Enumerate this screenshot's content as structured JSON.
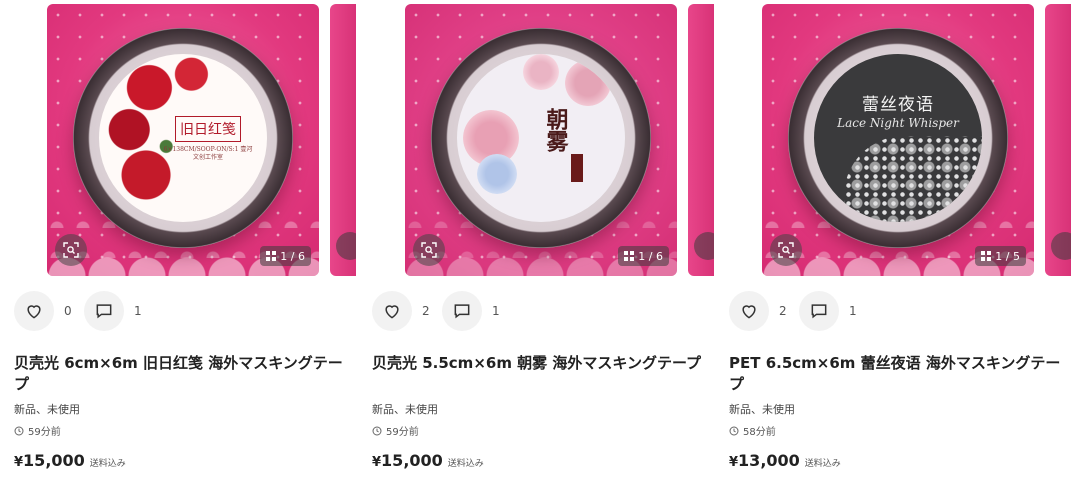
{
  "items": [
    {
      "likes": "0",
      "comments": "1",
      "title": "贝壳光 6cm×6m 旧日红笺 海外マスキングテープ",
      "condition": "新品、未使用",
      "time": "59分前",
      "currency": "¥",
      "price": "15,000",
      "shipping": "送料込み",
      "page_indicator": "1 / 6",
      "tape_label": "旧日红笺",
      "tape_sub": "6×138CM/SOOP-ON/S:1 壹河文创工作室"
    },
    {
      "likes": "2",
      "comments": "1",
      "title": "贝壳光 5.5cm×6m 朝雾 海外マスキングテープ",
      "condition": "新品、未使用",
      "time": "59分前",
      "currency": "¥",
      "price": "15,000",
      "shipping": "送料込み",
      "page_indicator": "1 / 6",
      "tape_label": "朝雾"
    },
    {
      "likes": "2",
      "comments": "1",
      "title": "PET 6.5cm×6m 蕾丝夜语 海外マスキングテープ",
      "condition": "新品、未使用",
      "time": "58分前",
      "currency": "¥",
      "price": "13,000",
      "shipping": "送料込み",
      "page_indicator": "1 / 5",
      "tape_label": "蕾丝夜语",
      "tape_sub": "Lace Night Whisper"
    }
  ],
  "icons": {
    "scan": "image-search-icon",
    "pages": "grid-icon",
    "like": "heart-icon",
    "comment": "comment-icon",
    "time": "clock-icon"
  },
  "colors": {
    "pink_bg": "#e2397f",
    "text": "#222222",
    "button_bg": "#f2f2f2"
  }
}
